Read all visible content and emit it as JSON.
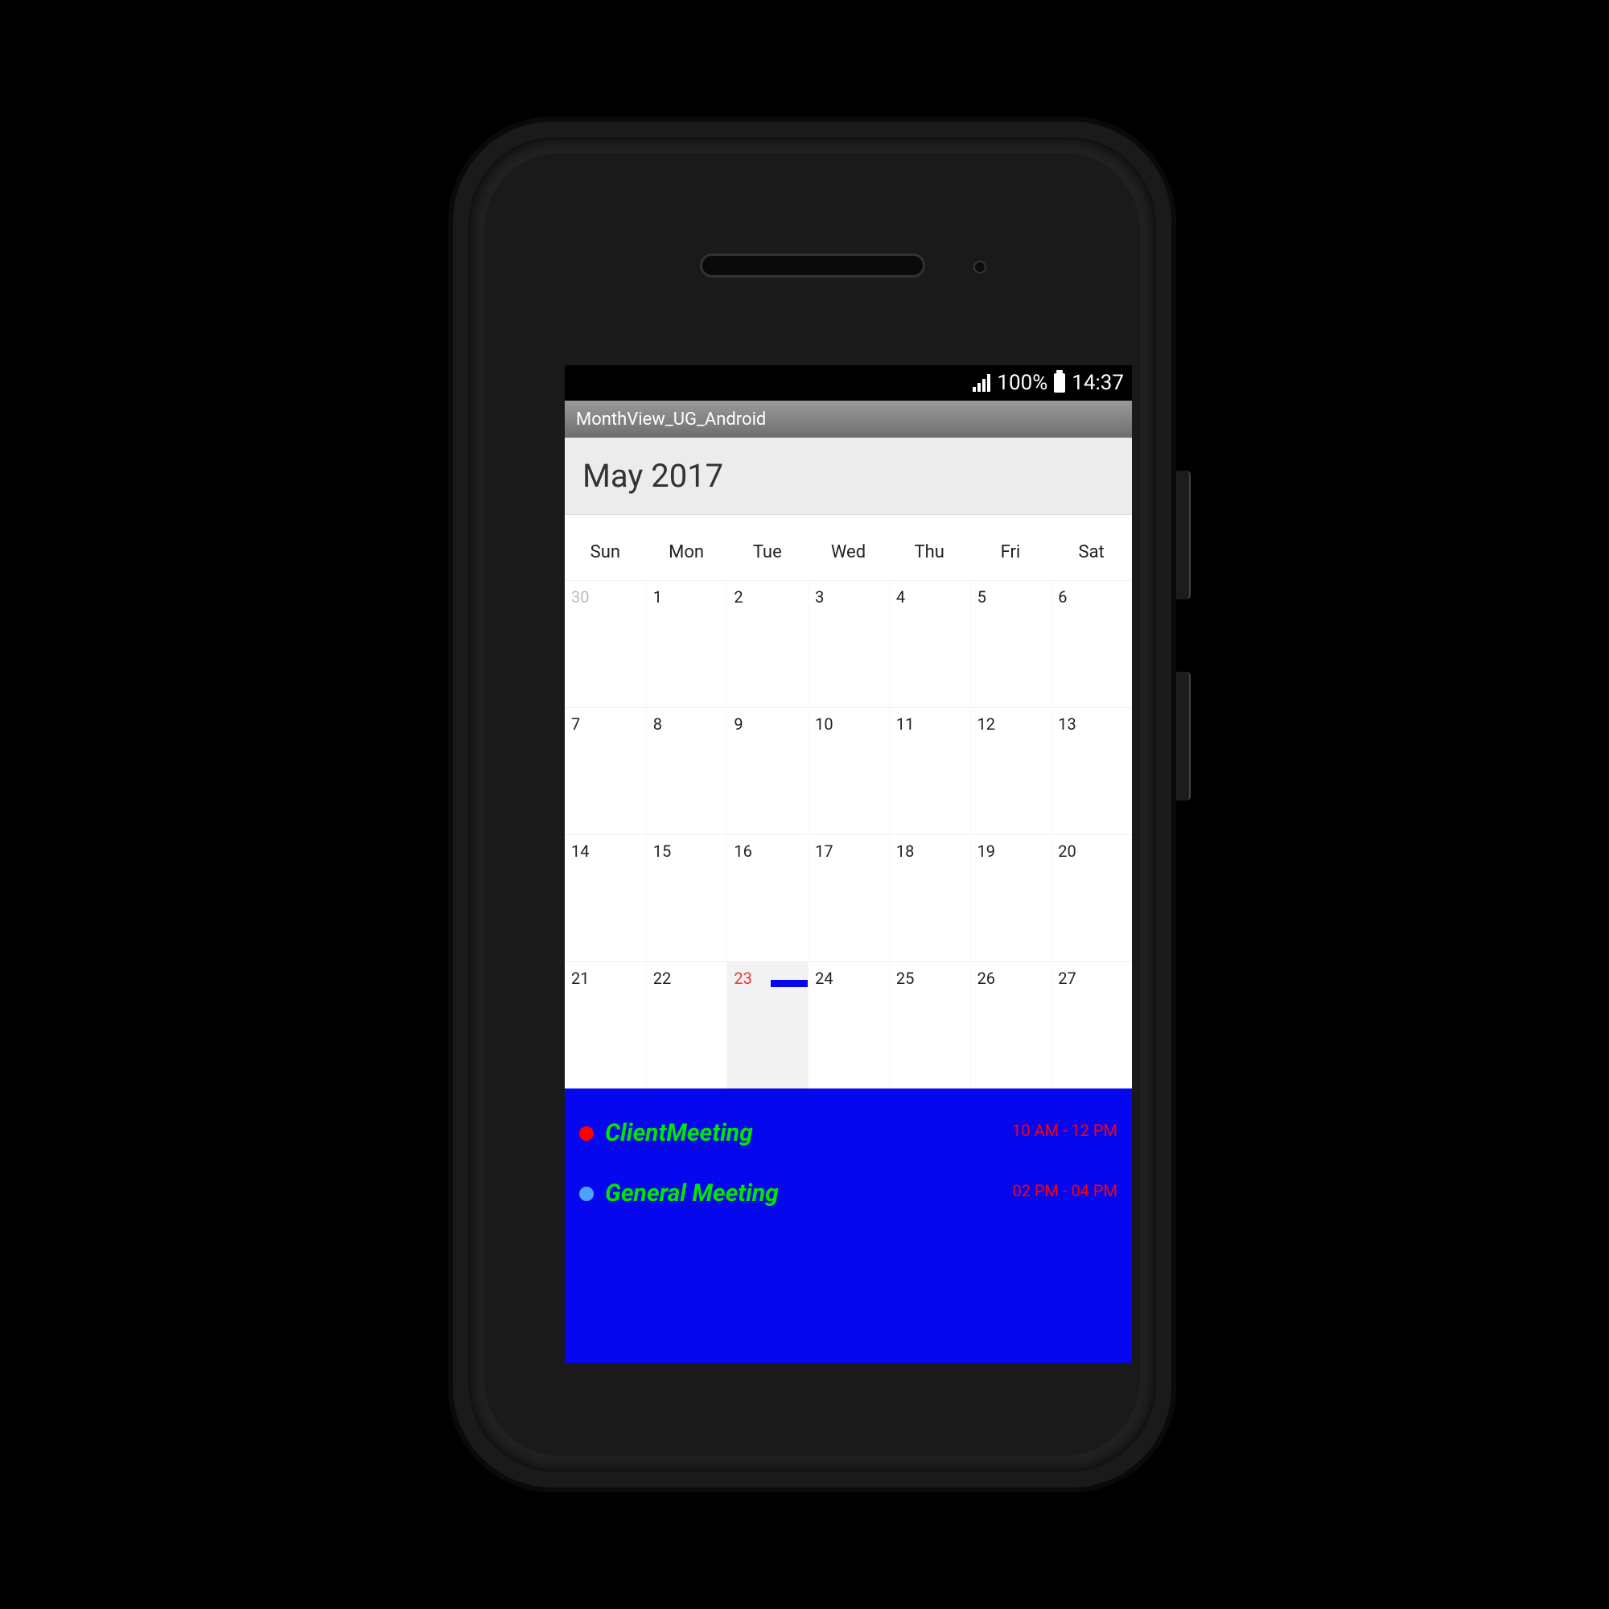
{
  "status": {
    "battery": "100%",
    "time": "14:37"
  },
  "app": {
    "title": "MonthView_UG_Android"
  },
  "calendar": {
    "month_label": "May 2017",
    "dow": [
      "Sun",
      "Mon",
      "Tue",
      "Wed",
      "Thu",
      "Fri",
      "Sat"
    ],
    "today": 23,
    "weeks": [
      [
        {
          "n": 30,
          "muted": true
        },
        {
          "n": 1
        },
        {
          "n": 2
        },
        {
          "n": 3
        },
        {
          "n": 4
        },
        {
          "n": 5
        },
        {
          "n": 6
        }
      ],
      [
        {
          "n": 7
        },
        {
          "n": 8
        },
        {
          "n": 9
        },
        {
          "n": 10
        },
        {
          "n": 11
        },
        {
          "n": 12
        },
        {
          "n": 13
        }
      ],
      [
        {
          "n": 14
        },
        {
          "n": 15
        },
        {
          "n": 16
        },
        {
          "n": 17
        },
        {
          "n": 18
        },
        {
          "n": 19
        },
        {
          "n": 20
        }
      ],
      [
        {
          "n": 21
        },
        {
          "n": 22
        },
        {
          "n": 23,
          "today": true,
          "event": true
        },
        {
          "n": 24
        },
        {
          "n": 25
        },
        {
          "n": 26
        },
        {
          "n": 27
        }
      ]
    ]
  },
  "agenda": [
    {
      "title": "ClientMeeting",
      "time": "10 AM - 12 PM",
      "dot": "red"
    },
    {
      "title": "General Meeting",
      "time": "02 PM - 04 PM",
      "dot": "blue"
    }
  ]
}
